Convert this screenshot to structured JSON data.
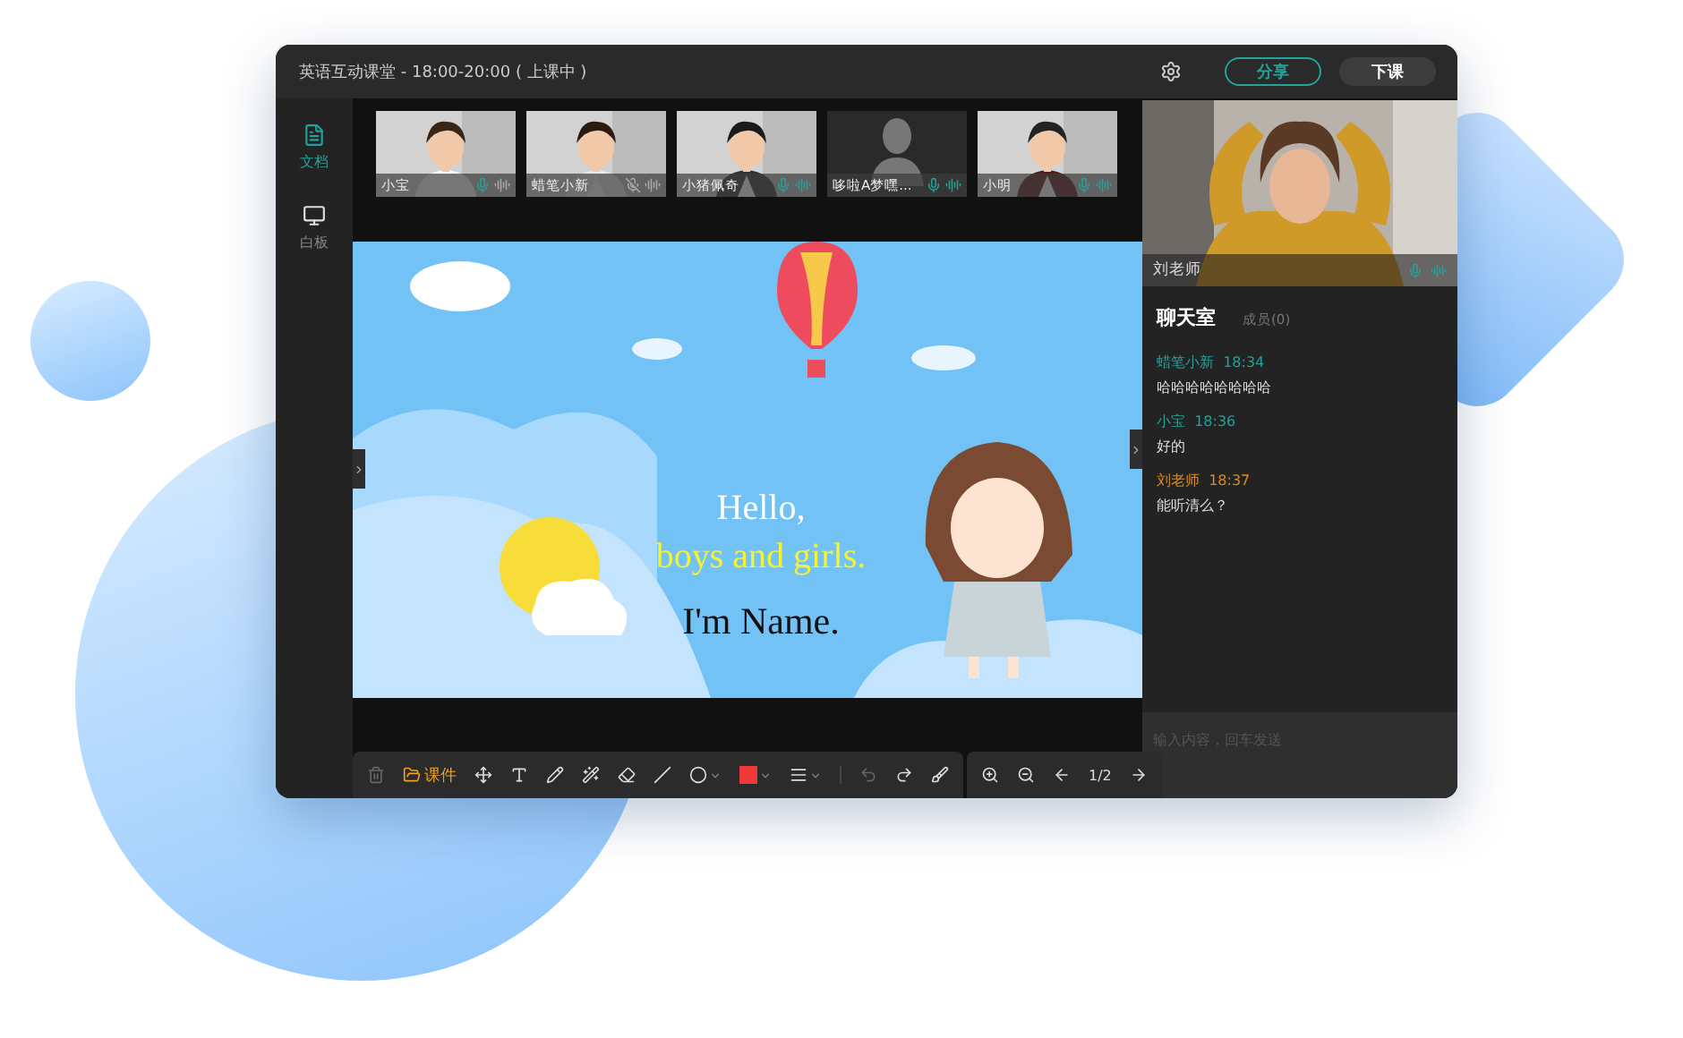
{
  "window": {
    "title": "英语互动课堂 - 18:00-20:00 ( 上课中 )"
  },
  "header_buttons": [
    {
      "label": "分享",
      "kind": "outline"
    },
    {
      "label": "下课",
      "kind": "filled"
    }
  ],
  "sidebar": {
    "items": [
      {
        "label": "文档",
        "selected": true,
        "kind": "document"
      },
      {
        "label": "白板",
        "selected": false,
        "kind": "board"
      }
    ]
  },
  "participants": [
    {
      "name": "小宝",
      "kind": "picture",
      "muted": false,
      "speaking": false
    },
    {
      "name": "蜡笔小新",
      "kind": "picture",
      "muted": true,
      "speaking": false
    },
    {
      "name": "小猪佩奇",
      "kind": "picture",
      "muted": false,
      "speaking": true
    },
    {
      "name": "哆啦A梦嘿...",
      "kind": "avatar",
      "muted": false,
      "speaking": true
    },
    {
      "name": "小明",
      "kind": "picture",
      "muted": false,
      "speaking": true
    }
  ],
  "slide": {
    "lines": [
      {
        "text": "Hello,",
        "kind": "plain"
      },
      {
        "text": "boys and girls.",
        "kind": "highlight"
      },
      {
        "text": "I'm Name.",
        "kind": "dark"
      }
    ]
  },
  "toolbar": {
    "courseware": "课件",
    "tools": [
      {
        "kind": "trash",
        "disabled": true
      },
      {
        "kind": "move",
        "disabled": false
      },
      {
        "kind": "text",
        "disabled": false
      },
      {
        "kind": "pen",
        "disabled": false
      },
      {
        "kind": "wand",
        "disabled": false
      },
      {
        "kind": "eraser",
        "disabled": false
      },
      {
        "kind": "line",
        "disabled": false
      },
      {
        "kind": "circle",
        "disabled": false
      },
      {
        "kind": "color",
        "color": "#f03a3a"
      },
      {
        "kind": "weight",
        "disabled": false
      },
      {
        "kind": "undo",
        "disabled": true
      },
      {
        "kind": "redo",
        "disabled": false
      },
      {
        "kind": "clear",
        "disabled": false
      }
    ],
    "page": "1/2"
  },
  "teacher": {
    "name": "刘老师",
    "muted": false,
    "speaking": true
  },
  "chat": {
    "title": "聊天室",
    "members": "成员(0)",
    "messages": [
      {
        "sender": "蜡笔小新",
        "time": "18:34",
        "text": "哈哈哈哈哈哈哈哈",
        "kind": "student"
      },
      {
        "sender": "小宝",
        "time": "18:36",
        "text": "好的",
        "kind": "student"
      },
      {
        "sender": "刘老师",
        "time": "18:37",
        "text": "能听清么？",
        "kind": "teacher"
      }
    ],
    "input": {
      "placeholder": "输入内容，回车发送"
    }
  }
}
